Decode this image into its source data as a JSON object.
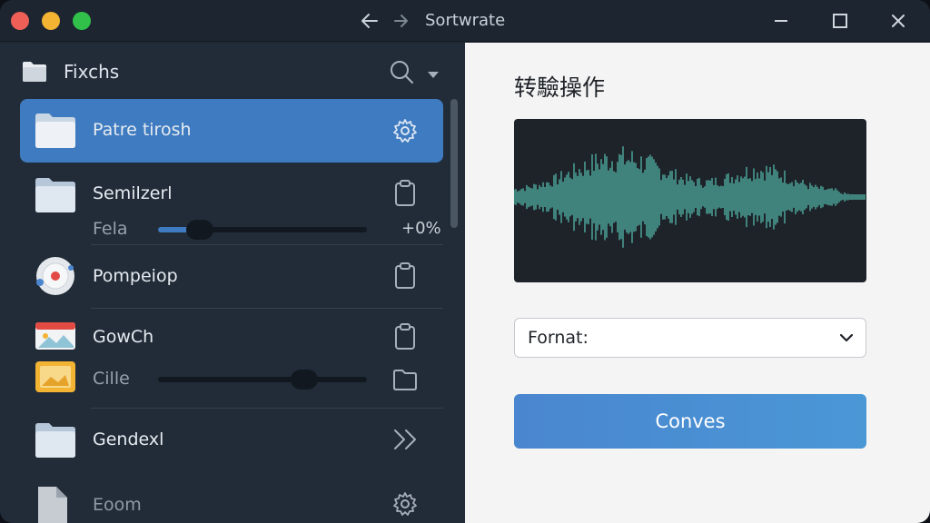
{
  "window": {
    "title": "Sortwrate"
  },
  "colors": {
    "accent": "#3f7bc0",
    "waveform": "#4a9a91",
    "button": "#4a8fd3"
  },
  "sidebar": {
    "header": {
      "title": "Fixchs",
      "icons": [
        "folder-icon",
        "search-icon",
        "caret-down-icon"
      ]
    },
    "items": [
      {
        "label": "Patre tirosh",
        "icon": "folder-icon",
        "action_icon": "gear-icon",
        "selected": true
      },
      {
        "label": "Semilzerl",
        "icon": "folder-icon",
        "action_icon": "clipboard-icon",
        "sub": {
          "label": "Fela",
          "value": "+0%",
          "slider_fraction": 0.2
        }
      },
      {
        "label": "Pompeiop",
        "icon": "disc-icon",
        "action_icon": "clipboard-icon"
      },
      {
        "label": "GowCh",
        "icon": "image-icon",
        "action_icon": "clipboard-icon",
        "sub": {
          "label": "Cille",
          "slider_fraction": 0.7
        },
        "sub_action_icon": "folder-outline-icon"
      },
      {
        "label": "Gendexl",
        "icon": "folder-icon",
        "action_icon": "double-chevron-icon"
      },
      {
        "label": "Eoom",
        "icon": "document-icon",
        "action_icon": "gear-icon"
      }
    ]
  },
  "panel": {
    "title": "转驗操作",
    "format": {
      "label": "Fornat:"
    },
    "convert_label": "Conves"
  }
}
